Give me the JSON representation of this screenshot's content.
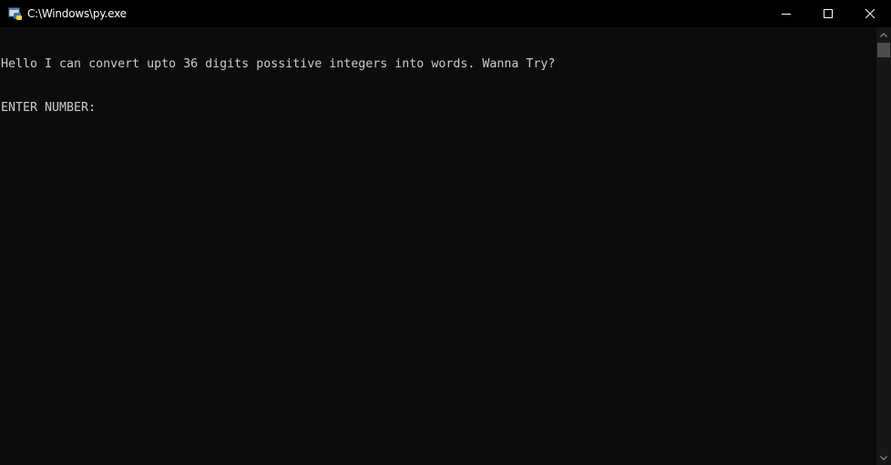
{
  "window": {
    "title": "C:\\Windows\\py.exe"
  },
  "icons": {
    "app": "python-console-icon",
    "minimize": "minimize-icon",
    "maximize": "maximize-icon",
    "close": "close-icon",
    "scroll_up": "scroll-up-arrow-icon",
    "scroll_down": "scroll-down-arrow-icon"
  },
  "console": {
    "lines": [
      "Hello I can convert upto 36 digits possitive integers into words. Wanna Try?",
      "ENTER NUMBER:"
    ]
  },
  "colors": {
    "titlebar_bg": "#000000",
    "console_bg": "#0c0c0c",
    "console_text": "#cccccc"
  }
}
